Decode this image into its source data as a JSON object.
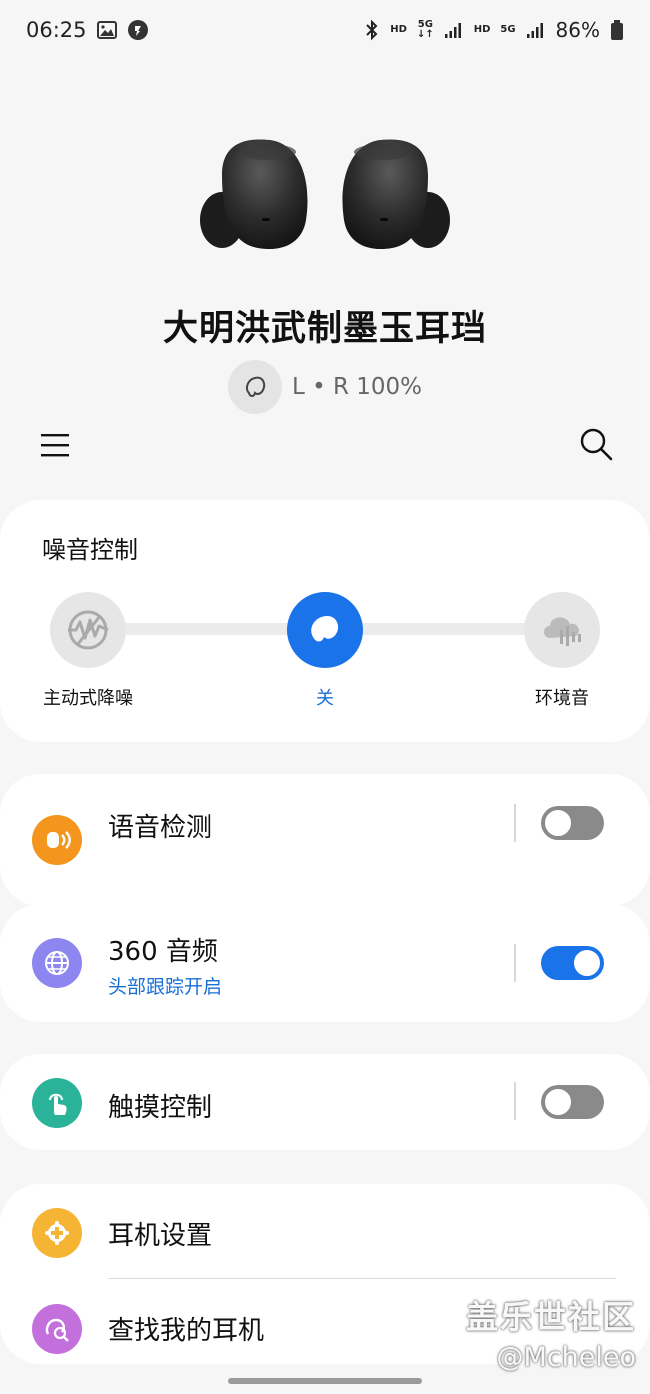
{
  "status": {
    "time": "06:25",
    "hd1": "HD",
    "net1": "5G",
    "hd2": "HD",
    "net2": "5G",
    "battery": "86%",
    "icons": [
      "gallery-icon",
      "app-notification-icon",
      "bluetooth-icon",
      "signal-icon",
      "battery-icon"
    ]
  },
  "device": {
    "name": "大明洪武制墨玉耳珰",
    "battery_label": "L • R 100%"
  },
  "noise_control": {
    "title": "噪音控制",
    "options": [
      "主动式降噪",
      "关",
      "环境音"
    ],
    "selected": "关",
    "accent": "#1a73e8"
  },
  "rows": {
    "voice_detect": {
      "title": "语音检测",
      "enabled": false,
      "icon_color": "#f4951e"
    },
    "audio360": {
      "title": "360 音频",
      "subtitle": "头部跟踪开启",
      "enabled": true,
      "icon_color": "#8d86f0"
    },
    "touch": {
      "title": "触摸控制",
      "enabled": false,
      "icon_color": "#2bb39a"
    },
    "settings": {
      "title": "耳机设置",
      "icon_color": "#f5b434"
    },
    "find": {
      "title": "查找我的耳机",
      "icon_color": "#c36fdc"
    }
  },
  "watermark": {
    "line1": "盖乐世社区",
    "line2": "@Mcheleo"
  }
}
